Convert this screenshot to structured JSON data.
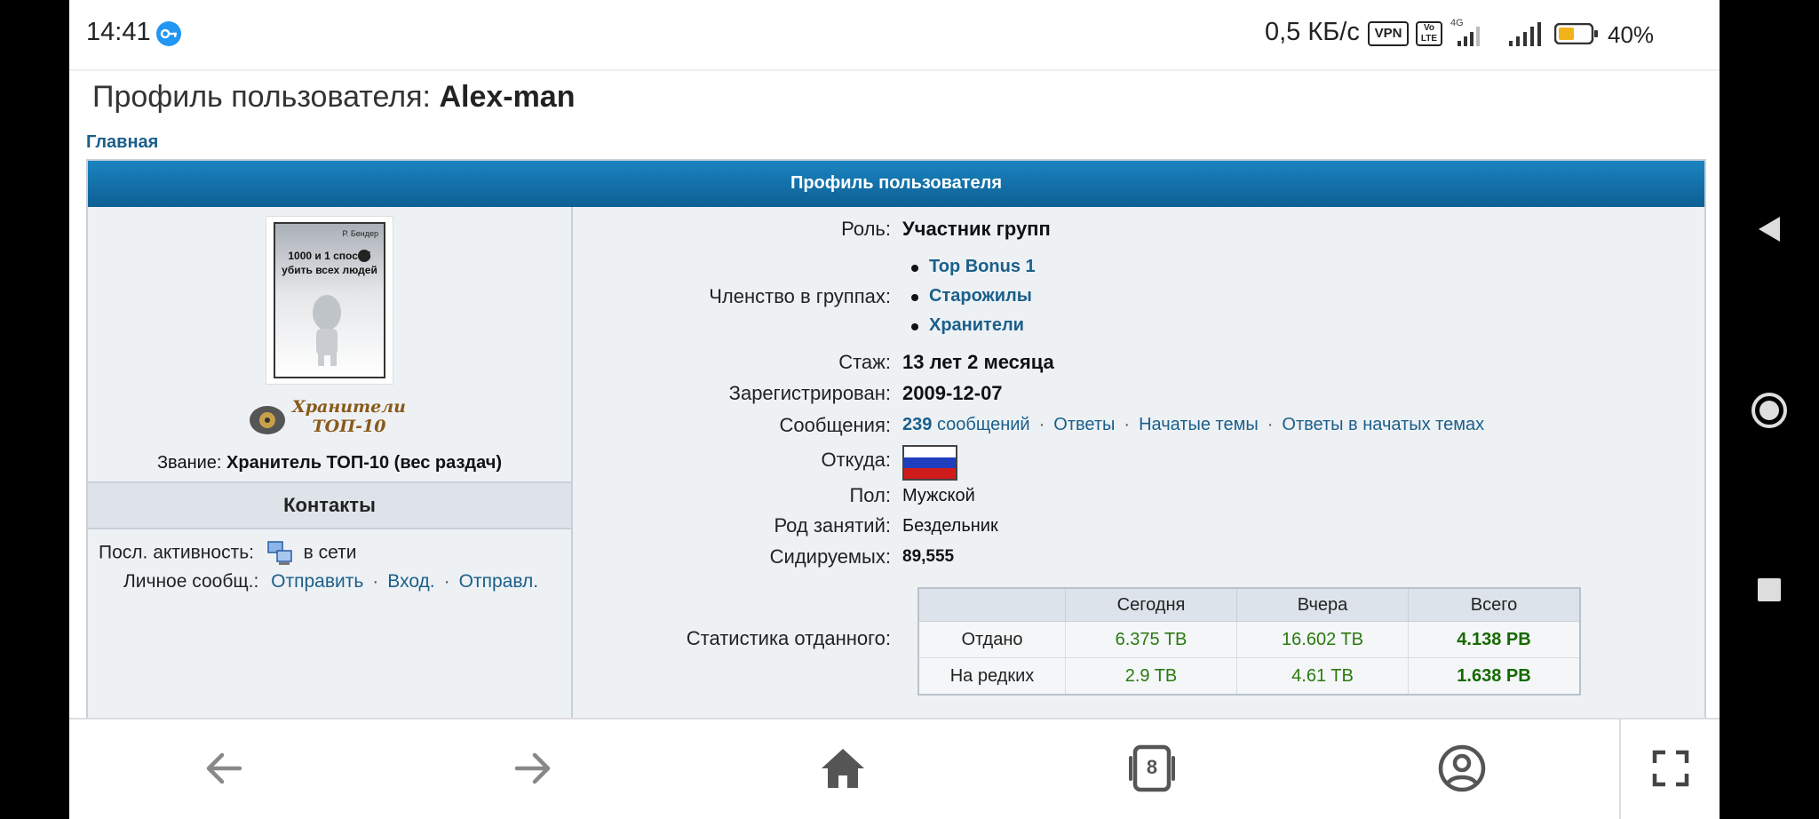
{
  "status_bar": {
    "time": "14:41",
    "speed": "0,5 КБ/с",
    "vpn": "VPN",
    "volte": "Vo LTE",
    "network": "4G",
    "battery": "40%"
  },
  "page": {
    "title_prefix": "Профиль пользователя:",
    "username": "Alex-man",
    "breadcrumb": "Главная",
    "header": "Профиль пользователя"
  },
  "left_panel": {
    "avatar_author": "Р. Бендер",
    "avatar_title": "1000 и 1 способ убить всех людей",
    "rank_image_text": "Хранители ТОП-10",
    "rank_label": "Звание:",
    "rank_value": "Хранитель ТОП-10 (вес раздач)",
    "contacts_header": "Контакты",
    "activity_label": "Посл. активность:",
    "activity_value": "в сети",
    "pm_label": "Личное сообщ.:",
    "pm_send": "Отправить",
    "pm_inbox": "Вход.",
    "pm_sent": "Отправл."
  },
  "right_panel": {
    "role_label": "Роль:",
    "role_value": "Участник групп",
    "groups_label": "Членство в группах:",
    "groups": [
      "Top Bonus 1",
      "Старожилы",
      "Хранители"
    ],
    "tenure_label": "Стаж:",
    "tenure_value": "13 лет 2 месяца",
    "registered_label": "Зарегистрирован:",
    "registered_value": "2009-12-07",
    "messages_label": "Сообщения:",
    "messages_count": "239",
    "messages_word": "сообщений",
    "messages_replies": "Ответы",
    "messages_topics": "Начатые темы",
    "messages_topic_replies": "Ответы в начатых темах",
    "from_label": "Откуда:",
    "gender_label": "Пол:",
    "gender_value": "Мужской",
    "occupation_label": "Род занятий:",
    "occupation_value": "Бездельник",
    "seeding_label": "Сидируемых:",
    "seeding_value": "89,555",
    "stats_label": "Статистика отданного:",
    "stats": {
      "headers": [
        "",
        "Сегодня",
        "Вчера",
        "Всего"
      ],
      "rows": [
        [
          "Отдано",
          "6.375 TB",
          "16.602 TB",
          "4.138 PB"
        ],
        [
          "На редких",
          "2.9 TB",
          "4.61 TB",
          "1.638 PB"
        ]
      ]
    }
  },
  "bottom_nav": {
    "tabs_count": "8",
    "icons": [
      "back-arrow-icon",
      "forward-arrow-icon",
      "home-icon",
      "tabs-icon",
      "account-icon",
      "fullscreen-icon"
    ]
  },
  "colors": {
    "accent_link": "#1a5f8a",
    "header_blue": "#0d5f93",
    "stat_green": "#2a7a10"
  }
}
